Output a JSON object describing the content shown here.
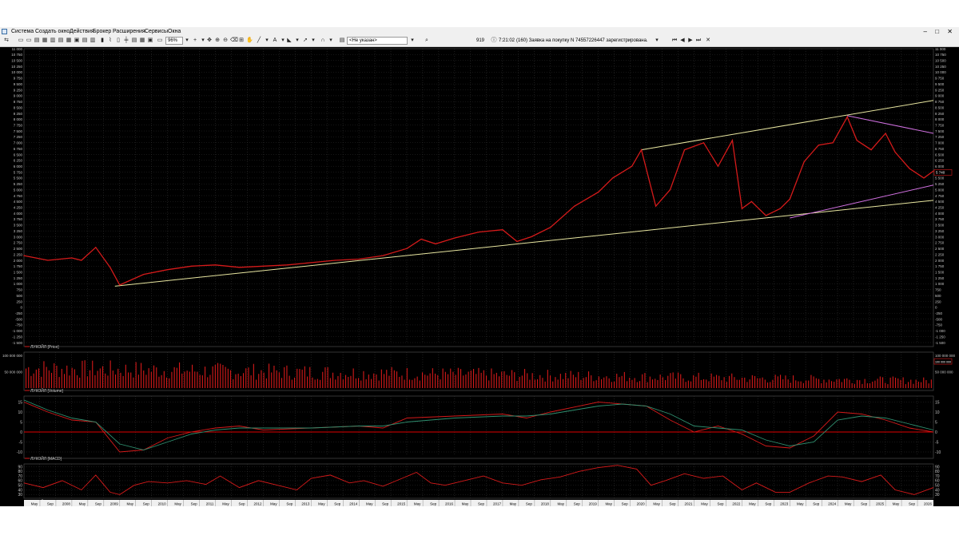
{
  "menubar": {
    "items": [
      "Система",
      "Создать окно",
      "Действия",
      "Брокер",
      "Расширения",
      "Сервисы",
      "Окна"
    ],
    "window_controls": [
      "–",
      "□",
      "✕"
    ]
  },
  "toolbar": {
    "zoom": "96%",
    "instrument_select": "<Не указан>",
    "message_count": "919",
    "message_time": "7:21:02",
    "message_text": "(160) Заявка на покупку N 74557226447 зарегистрирована."
  },
  "colors": {
    "background": "#000000",
    "price_line": "#d51a1a",
    "trend_line": "#e8e6a0",
    "channel_line": "#d070e0",
    "grid": "#3a3a3a",
    "axis_text": "#c8c8c8",
    "zero_line": "#e00000",
    "signal_line": "#2f8f6f"
  },
  "chart_data": [
    {
      "type": "line",
      "panel": "price",
      "legend": "ЛУКОЙЛ [Price]",
      "y_ticks": [
        "11 000",
        "10 750",
        "10 500",
        "10 250",
        "10 000",
        "9 750",
        "9 500",
        "9 250",
        "9 000",
        "8 750",
        "8 500",
        "8 250",
        "8 000",
        "7 750",
        "7 500",
        "7 250",
        "7 000",
        "6 750",
        "6 500",
        "6 250",
        "6 000",
        "5 750",
        "5 500",
        "5 250",
        "5 000",
        "4 750",
        "4 500",
        "4 250",
        "4 000",
        "3 750",
        "3 500",
        "3 250",
        "3 000",
        "2 750",
        "2 500",
        "2 250",
        "2 000",
        "1 750",
        "1 500",
        "1 250",
        "1 000",
        "750",
        "500",
        "250",
        "0",
        "-250",
        "-500",
        "-750",
        "-1 000",
        "-1 250",
        "-1 500"
      ],
      "ylim": [
        -1500,
        11000
      ],
      "last_price_label": "5 740",
      "x": [
        2007.0,
        2007.5,
        2008.0,
        2008.2,
        2008.5,
        2008.8,
        2009.0,
        2009.5,
        2010.0,
        2010.5,
        2011.0,
        2011.5,
        2012.0,
        2012.5,
        2013.0,
        2013.5,
        2014.0,
        2014.5,
        2015.0,
        2015.3,
        2015.6,
        2016.0,
        2016.5,
        2017.0,
        2017.3,
        2017.6,
        2018.0,
        2018.5,
        2019.0,
        2019.3,
        2019.7,
        2019.9,
        2020.2,
        2020.5,
        2020.8,
        2021.2,
        2021.5,
        2021.8,
        2022.0,
        2022.2,
        2022.5,
        2022.8,
        2023.0,
        2023.3,
        2023.6,
        2023.9,
        2024.2,
        2024.4,
        2024.7,
        2025.0,
        2025.2,
        2025.5,
        2025.8,
        2026.0
      ],
      "y": [
        2200,
        2000,
        2100,
        2000,
        2550,
        1700,
        950,
        1400,
        1600,
        1750,
        1800,
        1700,
        1750,
        1800,
        1900,
        2000,
        2050,
        2200,
        2500,
        2900,
        2700,
        2950,
        3200,
        3300,
        2800,
        3000,
        3400,
        4300,
        4900,
        5500,
        6000,
        6700,
        4300,
        5000,
        6700,
        7000,
        6000,
        7100,
        4200,
        4500,
        3900,
        4200,
        4600,
        6200,
        6900,
        7000,
        8100,
        7100,
        6700,
        7400,
        6600,
        5900,
        5500,
        5800
      ],
      "trend_lines": [
        {
          "from": [
            2008.9,
            900
          ],
          "to": [
            2026.0,
            4550
          ]
        },
        {
          "from": [
            2019.9,
            6700
          ],
          "to": [
            2026.0,
            8800
          ]
        }
      ],
      "channel_lines": [
        {
          "from": [
            2023.0,
            3800
          ],
          "to": [
            2026.0,
            5200
          ]
        },
        {
          "from": [
            2024.2,
            8150
          ],
          "to": [
            2026.0,
            7400
          ]
        }
      ]
    },
    {
      "type": "bar",
      "panel": "volume",
      "legend": "ЛУКОЙЛ [Volume]",
      "y_ticks": [
        "100 000 000",
        "50 000 000"
      ],
      "ylim": [
        0,
        110000000
      ],
      "last_volume_label": "100 000 000"
    },
    {
      "type": "line",
      "panel": "macd",
      "legend": "ЛУКОЙЛ [MACD]",
      "y_ticks": [
        "15",
        "10",
        "5",
        "0",
        "-5",
        "-10"
      ],
      "ylim": [
        -12,
        18
      ],
      "x": [
        2007.0,
        2007.5,
        2008.0,
        2008.5,
        2009.0,
        2009.5,
        2010.0,
        2010.5,
        2011.0,
        2011.5,
        2012.0,
        2013.0,
        2014.0,
        2014.5,
        2015.0,
        2016.0,
        2017.0,
        2017.5,
        2018.0,
        2019.0,
        2019.5,
        2020.0,
        2020.5,
        2021.0,
        2021.5,
        2022.0,
        2022.5,
        2023.0,
        2023.5,
        2024.0,
        2024.5,
        2025.0,
        2025.5,
        2026.0
      ],
      "series": [
        {
          "name": "MACD",
          "values": [
            15,
            10,
            6,
            5,
            -10,
            -9,
            -3,
            0,
            2,
            3,
            1,
            2,
            3,
            2,
            7,
            8,
            9,
            7,
            10,
            15,
            14,
            13,
            6,
            0,
            3,
            -1,
            -7,
            -8,
            -2,
            10,
            9,
            6,
            2,
            0
          ]
        },
        {
          "name": "Signal",
          "values": [
            16,
            11,
            7,
            5,
            -6,
            -9,
            -5,
            -1,
            1,
            2,
            2,
            2,
            3,
            3,
            5,
            7,
            8,
            8,
            9,
            13,
            14,
            13,
            9,
            3,
            2,
            1,
            -4,
            -7,
            -5,
            6,
            8,
            7,
            4,
            1
          ]
        }
      ]
    },
    {
      "type": "line",
      "panel": "rsi",
      "legend": "ЛУКОЙЛ [RSI]",
      "y_ticks": [
        "90",
        "80",
        "70",
        "60",
        "50",
        "40",
        "30"
      ],
      "ylim": [
        22,
        96
      ],
      "x": [
        2007.0,
        2007.4,
        2007.8,
        2008.2,
        2008.5,
        2008.8,
        2009.0,
        2009.3,
        2009.6,
        2010.0,
        2010.4,
        2010.8,
        2011.1,
        2011.5,
        2011.9,
        2012.3,
        2012.7,
        2013.0,
        2013.4,
        2013.8,
        2014.1,
        2014.5,
        2014.9,
        2015.2,
        2015.5,
        2015.8,
        2016.2,
        2016.6,
        2017.0,
        2017.4,
        2017.8,
        2018.2,
        2018.6,
        2019.0,
        2019.4,
        2019.8,
        2020.1,
        2020.4,
        2020.8,
        2021.2,
        2021.6,
        2022.0,
        2022.3,
        2022.7,
        2023.0,
        2023.4,
        2023.8,
        2024.1,
        2024.5,
        2024.9,
        2025.2,
        2025.6,
        2026.0
      ],
      "values": [
        55,
        45,
        60,
        40,
        72,
        35,
        30,
        50,
        58,
        55,
        60,
        52,
        70,
        45,
        60,
        50,
        40,
        65,
        72,
        55,
        60,
        48,
        65,
        78,
        55,
        50,
        60,
        70,
        55,
        50,
        62,
        68,
        80,
        88,
        93,
        85,
        50,
        60,
        75,
        65,
        70,
        40,
        55,
        35,
        35,
        55,
        70,
        68,
        58,
        72,
        40,
        30,
        45
      ]
    }
  ],
  "x_axis_labels": [
    "May",
    "Sep",
    "2008",
    "May",
    "Sep",
    "2009",
    "May",
    "Sep",
    "2010",
    "May",
    "Sep",
    "2011",
    "May",
    "Sep",
    "2012",
    "May",
    "Sep",
    "2013",
    "May",
    "Sep",
    "2014",
    "May",
    "Sep",
    "2015",
    "May",
    "Sep",
    "2016",
    "May",
    "Sep",
    "2017",
    "May",
    "Sep",
    "2018",
    "May",
    "Sep",
    "2019",
    "May",
    "Sep",
    "2020",
    "May",
    "Sep",
    "2021",
    "May",
    "Sep",
    "2022",
    "May",
    "Sep",
    "2023",
    "May",
    "Sep",
    "2024",
    "May",
    "Sep",
    "2025",
    "May",
    "Sep",
    "2026"
  ]
}
